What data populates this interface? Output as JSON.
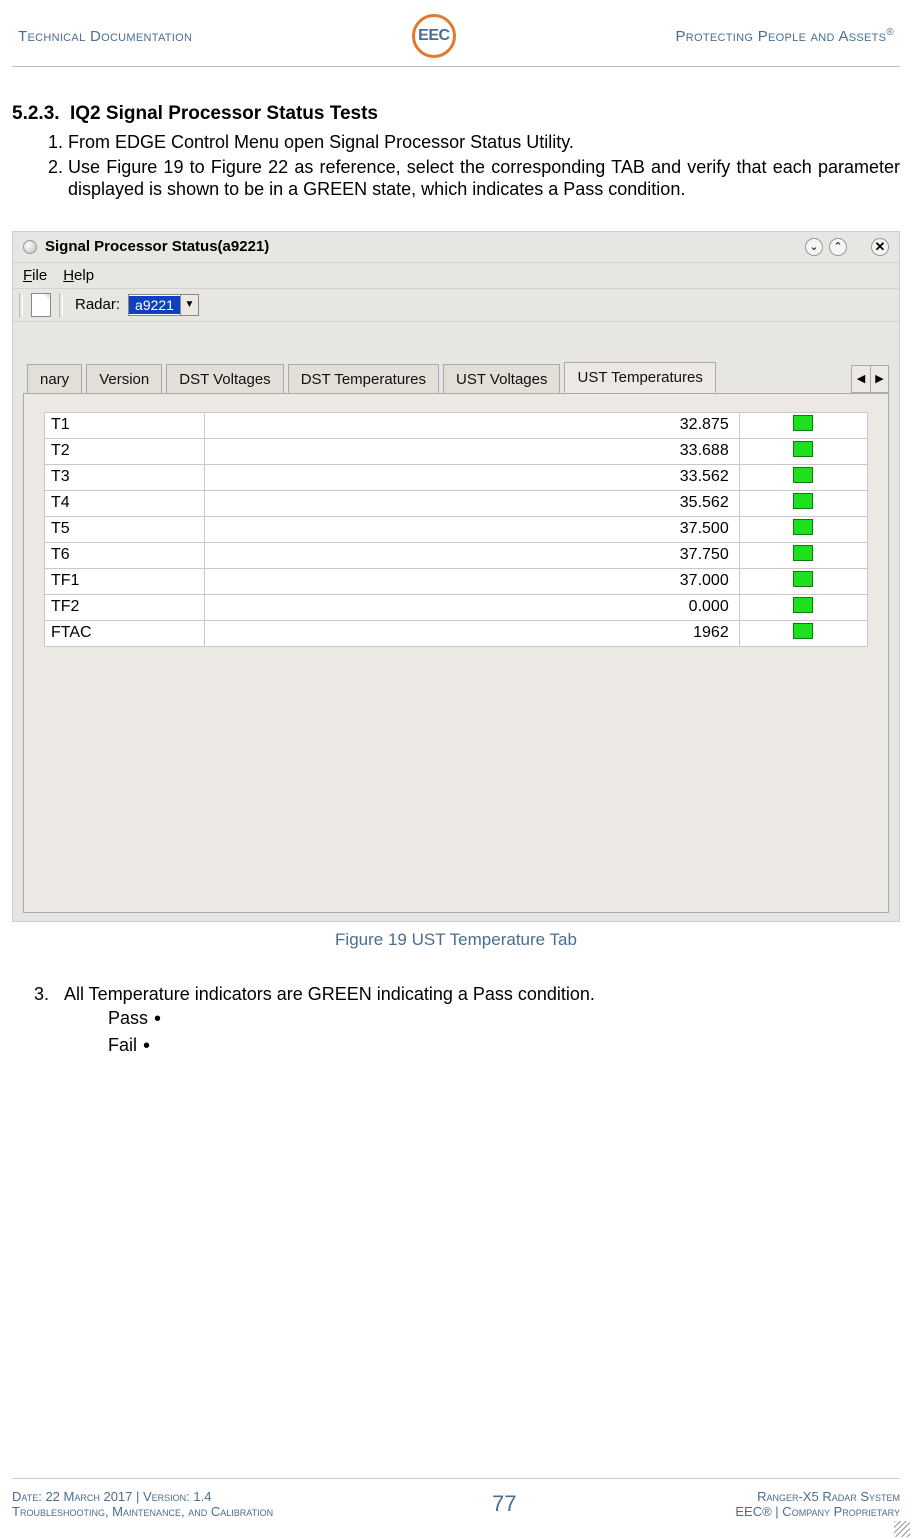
{
  "header": {
    "left": "Technical Documentation",
    "right": "Protecting People and Assets",
    "right_mark": "®",
    "logo_text": "EEC"
  },
  "section": {
    "number": "5.2.3.",
    "title": "IQ2 Signal Processor Status Tests",
    "step1": "From EDGE Control Menu open Signal Processor Status Utility.",
    "step2": "Use Figure 19 to Figure 22 as reference, select the corresponding TAB and verify that each parameter displayed is shown to be in a GREEN state, which indicates a Pass condition."
  },
  "window": {
    "title": "Signal Processor Status(a9221)",
    "menu": {
      "file": "File",
      "help": "Help"
    },
    "radar_label": "Radar:",
    "radar_value": "a9221",
    "tabs": [
      "nary",
      "Version",
      "DST Voltages",
      "DST Temperatures",
      "UST Voltages",
      "UST Temperatures"
    ],
    "active_tab_index": 5,
    "rows": [
      {
        "name": "T1",
        "value": "32.875"
      },
      {
        "name": "T2",
        "value": "33.688"
      },
      {
        "name": "T3",
        "value": "33.562"
      },
      {
        "name": "T4",
        "value": "35.562"
      },
      {
        "name": "T5",
        "value": "37.500"
      },
      {
        "name": "T6",
        "value": "37.750"
      },
      {
        "name": "TF1",
        "value": "37.000"
      },
      {
        "name": "TF2",
        "value": "0.000"
      },
      {
        "name": "FTAC",
        "value": "1962"
      }
    ]
  },
  "figure_caption": "Figure 19 UST Temperature Tab",
  "step3": {
    "num": "3.",
    "text": "All Temperature indicators are GREEN indicating a Pass condition.",
    "pass": "Pass",
    "fail": "Fail"
  },
  "footer": {
    "left_top": "Date: 22 March 2017 | Version: 1.4",
    "left_bottom": "Troubleshooting, Maintenance, and Calibration",
    "page": "77",
    "right_top": "Ranger-X5 Radar System",
    "right_bottom": "EEC® | Company Proprietary"
  }
}
